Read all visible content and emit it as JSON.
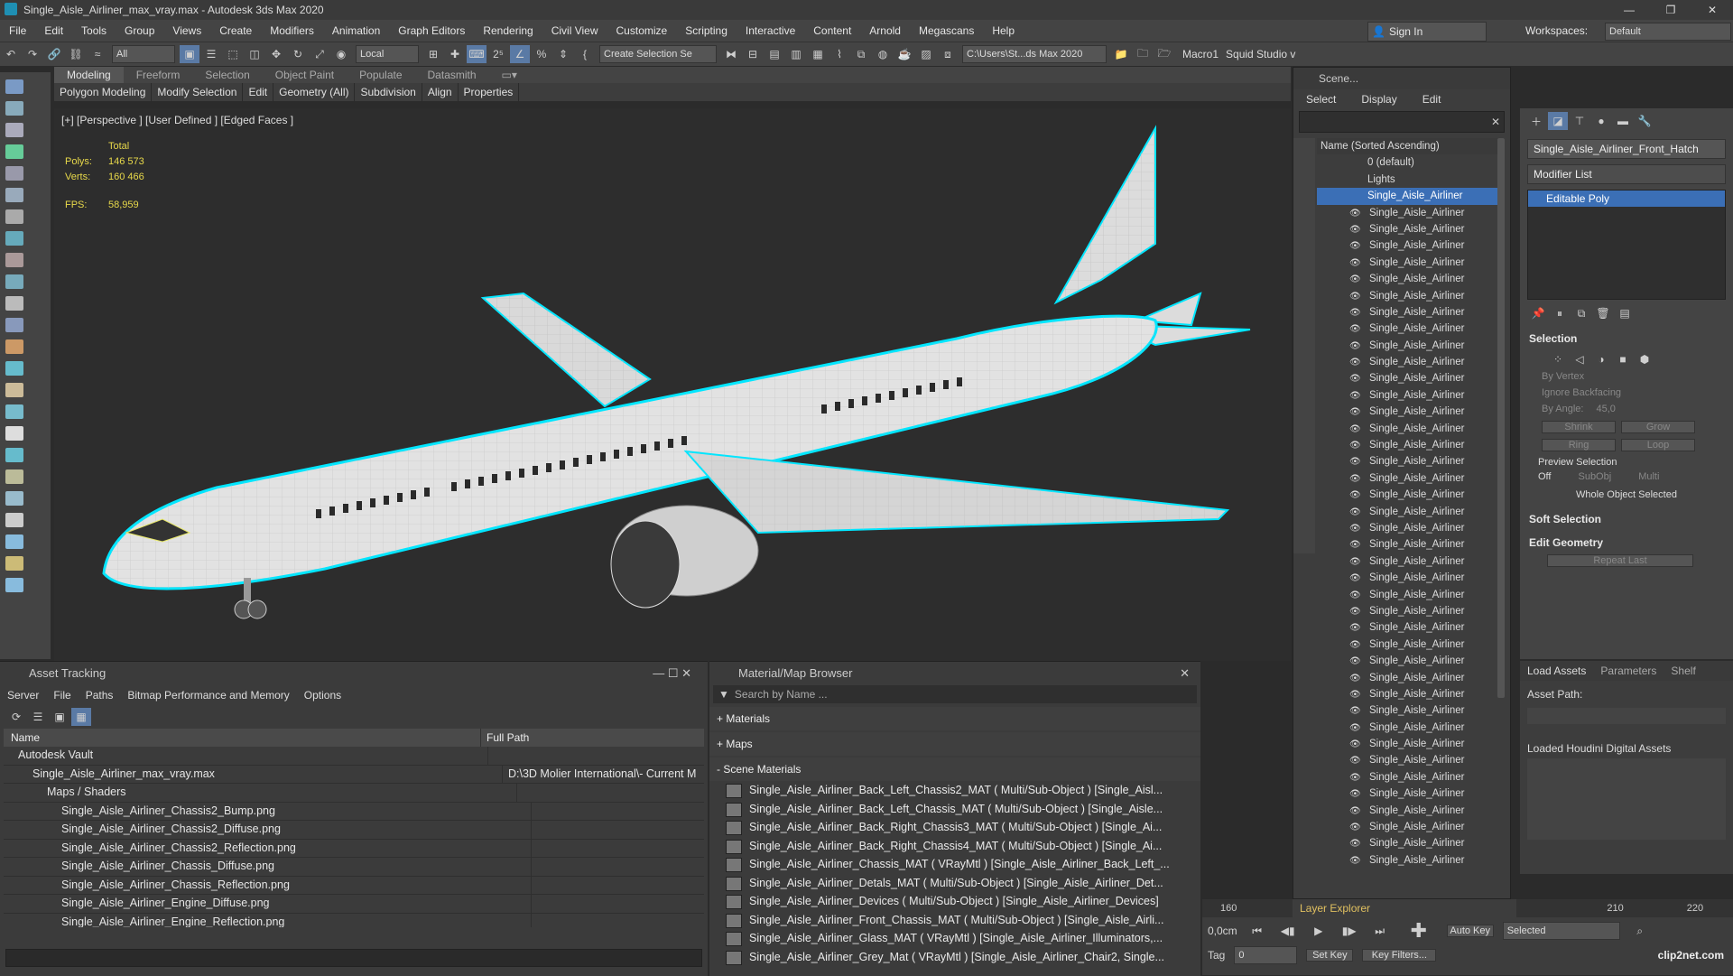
{
  "titlebar": {
    "title": "Single_Aisle_Airliner_max_vray.max - Autodesk 3ds Max 2020",
    "buttons": [
      "—",
      "❐",
      "✕"
    ]
  },
  "menubar": {
    "items": [
      "File",
      "Edit",
      "Tools",
      "Group",
      "Views",
      "Create",
      "Modifiers",
      "Animation",
      "Graph Editors",
      "Rendering",
      "Civil View",
      "Customize",
      "Scripting",
      "Interactive",
      "Content",
      "Arnold",
      "Megascans",
      "Help"
    ],
    "sign_in": "Sign In",
    "workspaces_label": "Workspaces:",
    "workspace": "Default"
  },
  "toolbar": {
    "filter": "All",
    "coord": "Local",
    "selection_set": "Create Selection Se",
    "path": "C:\\Users\\St...ds Max 2020",
    "macro": "Macro1",
    "squid": "Squid Studio v"
  },
  "ribbon": {
    "tabs": [
      "Modeling",
      "Freeform",
      "Selection",
      "Object Paint",
      "Populate",
      "Datasmith"
    ],
    "subtabs": [
      "Polygon Modeling",
      "Modify Selection",
      "Edit",
      "Geometry (All)",
      "Subdivision",
      "Align",
      "Properties"
    ]
  },
  "viewport": {
    "label": "[+] [Perspective ] [User Defined ] [Edged Faces ]",
    "total_label": "Total",
    "polys_label": "Polys:",
    "polys": "146 573",
    "verts_label": "Verts:",
    "verts": "160 466",
    "fps_label": "FPS:",
    "fps": "58,959"
  },
  "scene": {
    "title": "Scene...",
    "menu": [
      "Select",
      "Display",
      "Edit"
    ],
    "column": "Name (Sorted Ascending)",
    "default": "0 (default)",
    "lights": "Lights",
    "root": "Single_Aisle_Airliner",
    "child": "Single_Aisle_Airliner",
    "child_count": 40,
    "layer_explorer": "Layer Explorer"
  },
  "command_panel": {
    "object_name": "Single_Aisle_Airliner_Front_Hatch",
    "modifier_list": "Modifier List",
    "modifier": "Editable Poly",
    "selection": "Selection",
    "by_vertex": "By Vertex",
    "ignore_backfacing": "Ignore Backfacing",
    "by_angle": "By Angle:",
    "angle": "45,0",
    "shrink": "Shrink",
    "grow": "Grow",
    "ring": "Ring",
    "loop": "Loop",
    "preview_selection": "Preview Selection",
    "off": "Off",
    "subobj": "SubObj",
    "multi": "Multi",
    "whole_object": "Whole Object Selected",
    "soft_selection": "Soft Selection",
    "edit_geometry": "Edit Geometry",
    "repeat_last": "Repeat Last"
  },
  "houdini": {
    "tabs": [
      "Load Assets",
      "Parameters",
      "Shelf"
    ],
    "asset_path": "Asset Path:",
    "loaded": "Loaded Houdini Digital Assets"
  },
  "asset_tracking": {
    "title": "Asset Tracking",
    "menu": [
      "Server",
      "File",
      "Paths",
      "Bitmap Performance and Memory",
      "Options"
    ],
    "col_name": "Name",
    "col_path": "Full Path",
    "rows": [
      {
        "name": "Autodesk Vault",
        "path": "",
        "indent": 1
      },
      {
        "name": "Single_Aisle_Airliner_max_vray.max",
        "path": "D:\\3D Molier International\\- Current M",
        "indent": 2
      },
      {
        "name": "Maps / Shaders",
        "path": "",
        "indent": 3
      },
      {
        "name": "Single_Aisle_Airliner_Chassis2_Bump.png",
        "path": "",
        "indent": 4
      },
      {
        "name": "Single_Aisle_Airliner_Chassis2_Diffuse.png",
        "path": "",
        "indent": 4
      },
      {
        "name": "Single_Aisle_Airliner_Chassis2_Reflection.png",
        "path": "",
        "indent": 4
      },
      {
        "name": "Single_Aisle_Airliner_Chassis_Diffuse.png",
        "path": "",
        "indent": 4
      },
      {
        "name": "Single_Aisle_Airliner_Chassis_Reflection.png",
        "path": "",
        "indent": 4
      },
      {
        "name": "Single_Aisle_Airliner_Engine_Diffuse.png",
        "path": "",
        "indent": 4
      },
      {
        "name": "Single_Aisle_Airliner_Engine_Reflection.png",
        "path": "",
        "indent": 4
      }
    ]
  },
  "material_browser": {
    "title": "Material/Map Browser",
    "search_placeholder": "Search by Name ...",
    "materials": "+ Materials",
    "maps": "+ Maps",
    "scene_materials": "- Scene Materials",
    "rows": [
      "Single_Aisle_Airliner_Back_Left_Chassis2_MAT ( Multi/Sub-Object ) [Single_Aisl...",
      "Single_Aisle_Airliner_Back_Left_Chassis_MAT ( Multi/Sub-Object ) [Single_Aisle...",
      "Single_Aisle_Airliner_Back_Right_Chassis3_MAT ( Multi/Sub-Object ) [Single_Ai...",
      "Single_Aisle_Airliner_Back_Right_Chassis4_MAT ( Multi/Sub-Object ) [Single_Ai...",
      "Single_Aisle_Airliner_Chassis_MAT ( VRayMtl ) [Single_Aisle_Airliner_Back_Left_...",
      "Single_Aisle_Airliner_Detals_MAT ( Multi/Sub-Object ) [Single_Aisle_Airliner_Det...",
      "Single_Aisle_Airliner_Devices ( Multi/Sub-Object ) [Single_Aisle_Airliner_Devices]",
      "Single_Aisle_Airliner_Front_Chassis_MAT ( Multi/Sub-Object ) [Single_Aisle_Airli...",
      "Single_Aisle_Airliner_Glass_MAT ( VRayMtl ) [Single_Aisle_Airliner_Illuminators,...",
      "Single_Aisle_Airliner_Grey_Mat ( VRayMtl ) [Single_Aisle_Airliner_Chair2, Single..."
    ]
  },
  "timeline": {
    "t160": "160",
    "t210": "210",
    "t220": "220",
    "t0": "0",
    "cm": "0,0cm",
    "tag": "Tag",
    "auto_key": "Auto Key",
    "selected": "Selected",
    "set_key": "Set Key",
    "key_filters": "Key Filters...",
    "watermark": "clip2net.com"
  },
  "colors": {
    "accent": "#5a7aa5",
    "stats": "#e8d94a",
    "selection": "#00e6ff",
    "tree_selected": "#3b6fb6"
  }
}
